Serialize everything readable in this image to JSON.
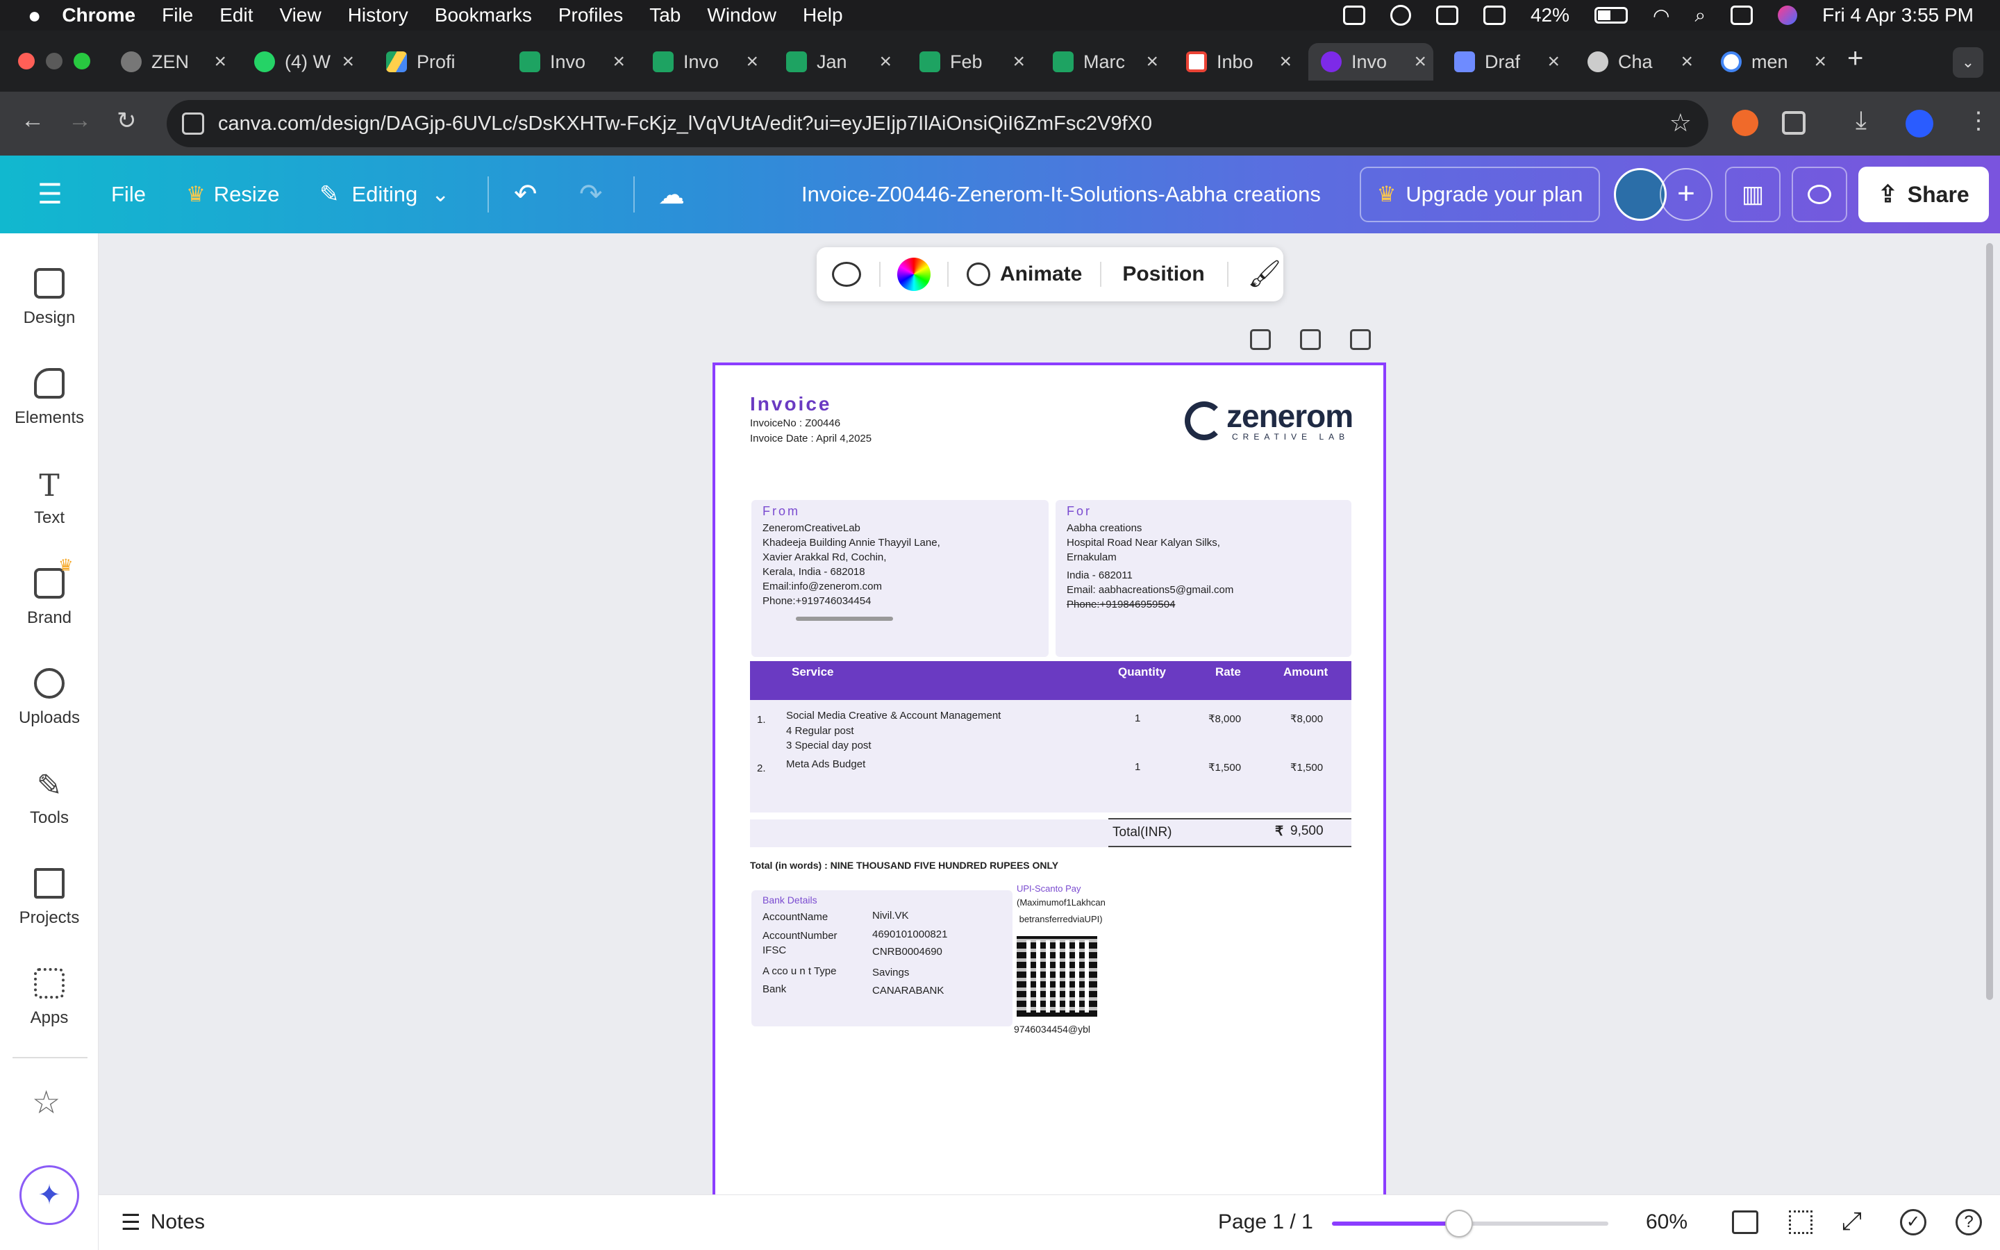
{
  "menubar": {
    "app": "Chrome",
    "items": [
      "File",
      "Edit",
      "View",
      "History",
      "Bookmarks",
      "Profiles",
      "Tab",
      "Window",
      "Help"
    ],
    "battery": "42%",
    "datetime": "Fri 4 Apr  3:55 PM"
  },
  "tabs": [
    {
      "label": "ZEN",
      "color": "#888"
    },
    {
      "label": "(4) W",
      "color": "#25d366"
    },
    {
      "label": "Profi",
      "color": "#f4b400"
    },
    {
      "label": "Invo",
      "color": "#1ea362"
    },
    {
      "label": "Invo",
      "color": "#1ea362"
    },
    {
      "label": "Jan",
      "color": "#1ea362"
    },
    {
      "label": "Feb",
      "color": "#1ea362"
    },
    {
      "label": "Marc",
      "color": "#1ea362"
    },
    {
      "label": "Inbo",
      "color": "#ea4335"
    },
    {
      "label": "Invo",
      "color": "#7d2ae8"
    },
    {
      "label": "Draf",
      "color": "#6e8bff"
    },
    {
      "label": "Cha",
      "color": "#cccccc"
    },
    {
      "label": "men",
      "color": "#4285f4"
    }
  ],
  "address": {
    "url": "canva.com/design/DAGjp-6UVLc/sDsKXHTw-FcKjz_lVqVUtA/edit?ui=eyJEIjp7IlAiOnsiQiI6ZmFsc2V9fX0"
  },
  "canva": {
    "file": "File",
    "resize": "Resize",
    "editing": "Editing",
    "doc_title": "Invoice-Z00446-Zenerom-It-Solutions-Aabha creations",
    "upgrade": "Upgrade your plan",
    "share": "Share"
  },
  "rail": [
    "Design",
    "Elements",
    "Text",
    "Brand",
    "Uploads",
    "Tools",
    "Projects",
    "Apps"
  ],
  "floating_toolbar": {
    "animate": "Animate",
    "position": "Position"
  },
  "invoice": {
    "title": "Invoice",
    "invoice_no": "InvoiceNo : Z00446",
    "invoice_date": "Invoice Date : April 4,2025",
    "logo_name": "zenerom",
    "logo_sub": "CREATIVE LAB",
    "from_label": "From",
    "from_lines": [
      "ZeneromCreativeLab",
      "Khadeeja Building Annie Thayyil Lane,",
      "Xavier Arakkal Rd, Cochin,",
      "Kerala, India - 682018",
      "Email:info@zenerom.com",
      "Phone:+919746034454"
    ],
    "for_label": "For",
    "for_lines": [
      "Aabha creations",
      "Hospital Road Near Kalyan Silks,",
      "Ernakulam",
      "India - 682011",
      "Email: aabhacreations5@gmail.com",
      "Phone:+919846959504"
    ],
    "headers": {
      "service": "Service",
      "quantity": "Quantity",
      "rate": "Rate",
      "amount": "Amount"
    },
    "items": [
      {
        "no": "1.",
        "service": "Social Media Creative & Account Management",
        "sub1": "4 Regular post",
        "sub2": "3 Special day post",
        "qty": "1",
        "rate": "₹8,000",
        "amount": "₹8,000"
      },
      {
        "no": "2.",
        "service": "Meta Ads Budget",
        "sub1": "",
        "sub2": "",
        "qty": "1",
        "rate": "₹1,500",
        "amount": "₹1,500"
      }
    ],
    "total_label": "Total(INR)",
    "total_symbol": "₹",
    "total_value": "9,500",
    "words": "Total (in words) : NINE THOUSAND FIVE HUNDRED RUPEES ONLY",
    "bank_title": "Bank Details",
    "bank": [
      {
        "k": "AccountName",
        "v": "Nivil.VK"
      },
      {
        "k": "AccountNumber",
        "v": "4690101000821"
      },
      {
        "k": "IFSC",
        "v": "CNRB0004690"
      },
      {
        "k": "A cco u n t Type",
        "v": "Savings"
      },
      {
        "k": "Bank",
        "v": "CANARABANK"
      }
    ],
    "upi_title": "UPI-Scanto Pay",
    "upi_note1": "(Maximumof1Lakhcan",
    "upi_note2": " betransferredviaUPI)",
    "upi_id": "9746034454@ybl"
  },
  "bottom": {
    "notes": "Notes",
    "page": "Page 1 / 1",
    "zoom": "60%",
    "zoom_level": 0.46
  },
  "colors": {
    "accent": "#8b3dff",
    "table_header": "#6a3ac2",
    "box_bg": "#efedf8"
  }
}
